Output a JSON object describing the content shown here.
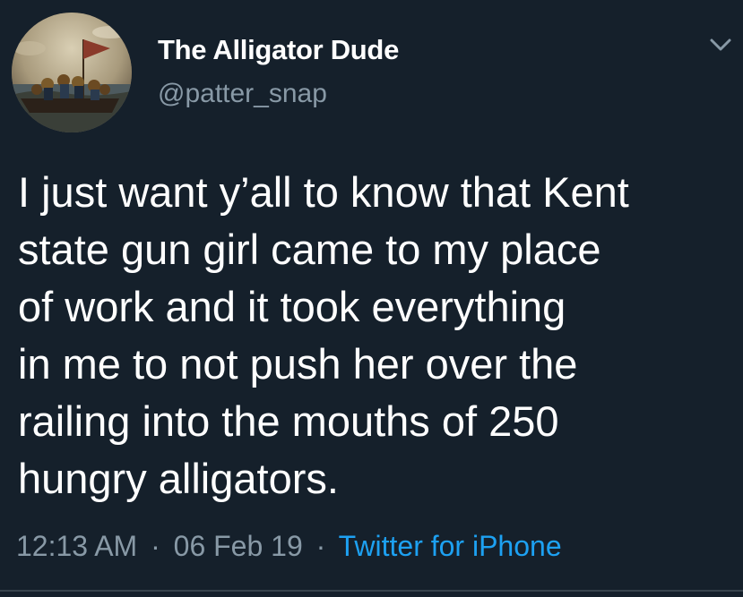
{
  "tweet": {
    "author": {
      "display_name": "The Alligator Dude",
      "handle": "@patter_snap",
      "avatar_icon": "painting-avatar-icon"
    },
    "menu_icon": "chevron-down-icon",
    "text_lines": [
      "I just want y’all to know that Kent",
      "state gun girl came to my place",
      "of work and it took everything",
      "in me to not push her over the",
      "railing into the mouths of 250",
      "hungry alligators."
    ],
    "meta": {
      "time": "12:13 AM",
      "separator": "·",
      "date": "06 Feb 19",
      "source": "Twitter for iPhone"
    }
  },
  "colors": {
    "background": "#15202b",
    "primary_text": "#ffffff",
    "secondary_text": "#8899a6",
    "link": "#1da1f2",
    "divider": "#38444d"
  }
}
